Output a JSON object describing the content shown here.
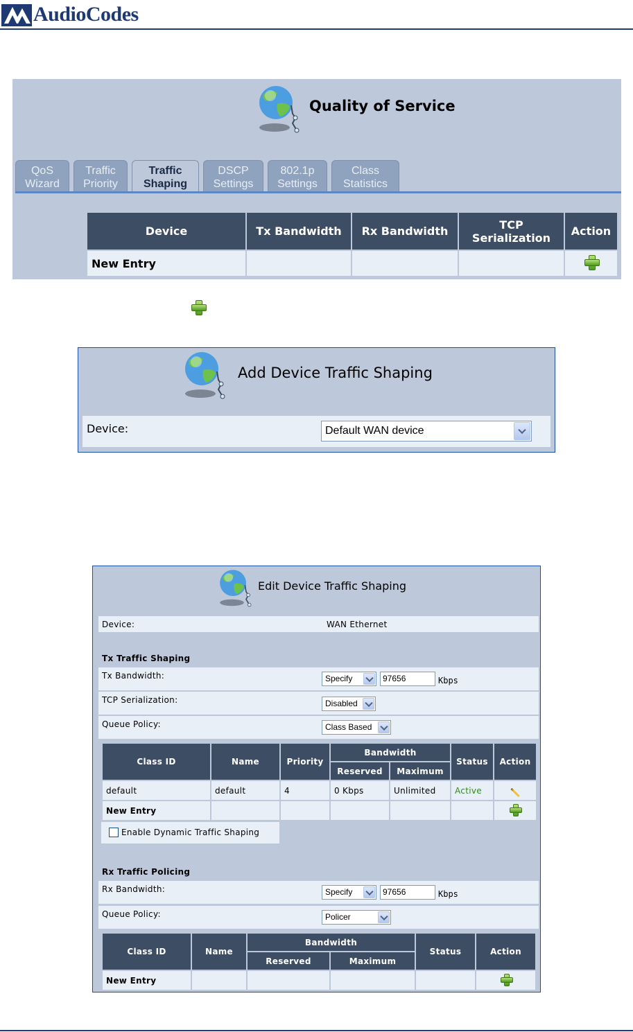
{
  "header": {
    "brand": "AudioCodes"
  },
  "qos_panel": {
    "title": "Quality of Service",
    "tabs": [
      {
        "line1": "QoS",
        "line2": "Wizard",
        "active": false
      },
      {
        "line1": "Traffic",
        "line2": "Priority",
        "active": false
      },
      {
        "line1": "Traffic",
        "line2": "Shaping",
        "active": true
      },
      {
        "line1": "DSCP",
        "line2": "Settings",
        "active": false
      },
      {
        "line1": "802.1p",
        "line2": "Settings",
        "active": false
      },
      {
        "line1": "Class",
        "line2": "Statistics",
        "active": false
      }
    ],
    "table": {
      "headers": [
        "Device",
        "Tx Bandwidth",
        "Rx Bandwidth",
        "TCP Serialization",
        "Action"
      ],
      "header_tcp_line1": "TCP",
      "header_tcp_line2": "Serialization",
      "new_entry": "New Entry"
    }
  },
  "add_panel": {
    "title": "Add Device Traffic Shaping",
    "device_label": "Device:",
    "device_value": "Default WAN device"
  },
  "edit_panel": {
    "title": "Edit Device Traffic Shaping",
    "device_label": "Device:",
    "device_value": "WAN Ethernet",
    "tx": {
      "section": "Tx Traffic Shaping",
      "bandwidth_label": "Tx Bandwidth:",
      "bandwidth_mode": "Specify",
      "bandwidth_value": "97656",
      "bandwidth_unit": "Kbps",
      "tcp_label": "TCP Serialization:",
      "tcp_value": "Disabled",
      "queue_label": "Queue Policy:",
      "queue_value": "Class Based"
    },
    "tx_table": {
      "headers": {
        "class_id": "Class ID",
        "name": "Name",
        "priority": "Priority",
        "bandwidth": "Bandwidth",
        "reserved": "Reserved",
        "maximum": "Maximum",
        "status": "Status",
        "action": "Action"
      },
      "rows": [
        {
          "class_id": "default",
          "name": "default",
          "priority": "4",
          "reserved": "0 Kbps",
          "maximum": "Unlimited",
          "status": "Active"
        }
      ],
      "new_entry": "New Entry"
    },
    "dynamic_shaping_label": "Enable Dynamic Traffic Shaping",
    "dynamic_shaping_checked": false,
    "rx": {
      "section": "Rx Traffic Policing",
      "bandwidth_label": "Rx Bandwidth:",
      "bandwidth_mode": "Specify",
      "bandwidth_value": "97656",
      "bandwidth_unit": "Kbps",
      "queue_label": "Queue Policy:",
      "queue_value": "Policer"
    },
    "rx_table": {
      "headers": {
        "class_id": "Class ID",
        "name": "Name",
        "bandwidth": "Bandwidth",
        "reserved": "Reserved",
        "maximum": "Maximum",
        "status": "Status",
        "action": "Action"
      },
      "new_entry": "New Entry"
    }
  },
  "colors": {
    "brand": "#1f3a73",
    "panel_bg": "#bdc9da",
    "table_header": "#3d4d63",
    "row_bg": "#e9eff7",
    "status_active": "#2e8b1e"
  }
}
